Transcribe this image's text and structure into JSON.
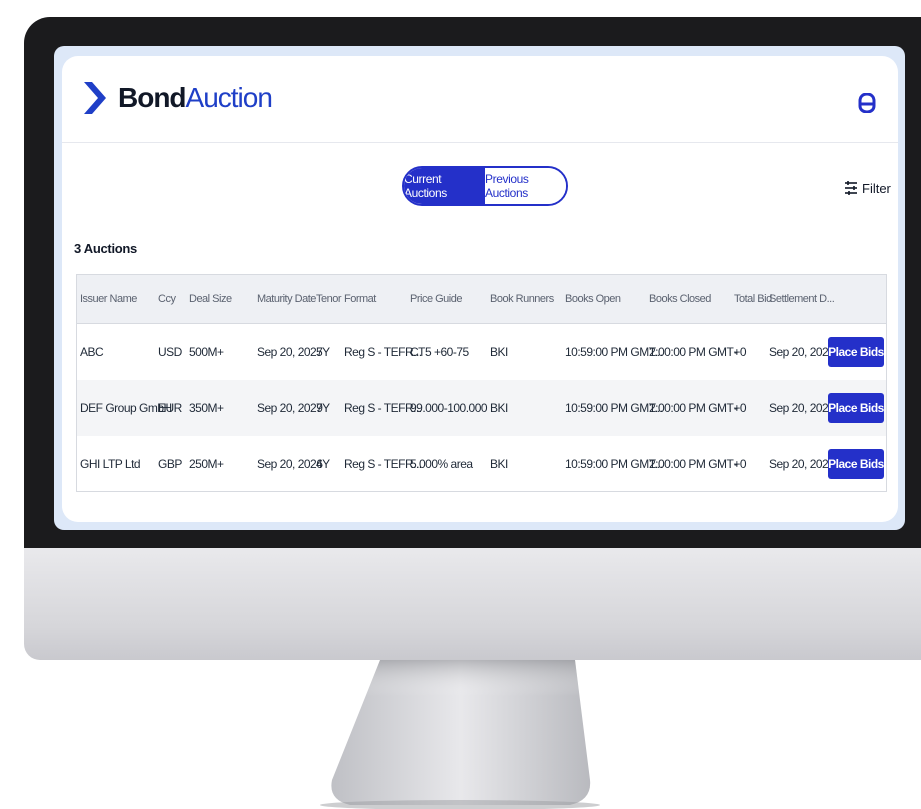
{
  "brand": {
    "name_bold": "Bond",
    "name_light": "Auction",
    "accent_color": "#2430c9"
  },
  "header": {
    "user_icon": "user-icon"
  },
  "tabs": [
    {
      "label": "Current Auctions",
      "active": true
    },
    {
      "label": "Previous Auctions",
      "active": false
    }
  ],
  "filter": {
    "label": "Filter",
    "icon": "sliders-icon"
  },
  "auction_count": "3 Auctions",
  "table": {
    "columns": [
      "Issuer Name",
      "Ccy",
      "Deal Size",
      "Maturity Date",
      "Tenor",
      "Format",
      "Price Guide",
      "Book Runners",
      "Books Open",
      "Books Closed",
      "Total Bid",
      "Settlement D..."
    ],
    "rows": [
      {
        "issuer": "ABC",
        "ccy": "USD",
        "deal_size": "500M+",
        "maturity": "Sep 20, 2027",
        "tenor": "5Y",
        "format": "Reg S - TEFR...",
        "price_guide": "CT5 +60-75",
        "book_runners": "BKI",
        "books_open": "10:59:00 PM GMT...",
        "books_closed": "2:00:00 PM GMT+0",
        "total_bid": "-",
        "settlement": "Sep 20, 2022",
        "action": "Place Bids"
      },
      {
        "issuer": "DEF Group GmbH",
        "ccy": "EUR",
        "deal_size": "350M+",
        "maturity": "Sep 20, 2029",
        "tenor": "7Y",
        "format": "Reg S - TEFR...",
        "price_guide": "99.000-100.000",
        "book_runners": "BKI",
        "books_open": "10:59:00 PM GMT...",
        "books_closed": "2:00:00 PM GMT+0",
        "total_bid": "-",
        "settlement": "Sep 20, 2022",
        "action": "Place Bids"
      },
      {
        "issuer": "GHI LTP Ltd",
        "ccy": "GBP",
        "deal_size": "250M+",
        "maturity": "Sep 20, 2026",
        "tenor": "4Y",
        "format": "Reg S - TEFR...",
        "price_guide": "5.000% area",
        "book_runners": "BKI",
        "books_open": "10:59:00 PM GMT...",
        "books_closed": "2:00:00 PM GMT+0",
        "total_bid": "-",
        "settlement": "Sep 20, 2022",
        "action": "Place Bids"
      }
    ]
  }
}
